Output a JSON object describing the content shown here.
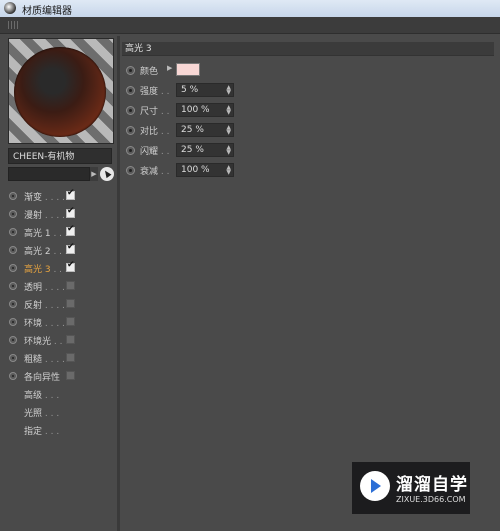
{
  "window": {
    "title": "材质编辑器"
  },
  "material": {
    "name": "CHEEN-有机物"
  },
  "channels": [
    {
      "label": "渐变",
      "dots": " . . . .",
      "checked": true,
      "active": false
    },
    {
      "label": "漫射",
      "dots": " . . . .",
      "checked": true,
      "active": false
    },
    {
      "label": "高光 1",
      "dots": " . . .",
      "checked": true,
      "active": false
    },
    {
      "label": "高光 2",
      "dots": " . . .",
      "checked": true,
      "active": false
    },
    {
      "label": "高光 3",
      "dots": " . . .",
      "checked": true,
      "active": true
    },
    {
      "label": "透明",
      "dots": " . . . .",
      "checked": false,
      "active": false
    },
    {
      "label": "反射",
      "dots": " . . . .",
      "checked": false,
      "active": false
    },
    {
      "label": "环境",
      "dots": " . . . .",
      "checked": false,
      "active": false
    },
    {
      "label": "环境光",
      "dots": " . .",
      "checked": false,
      "active": false
    },
    {
      "label": "粗糙",
      "dots": " . . . .",
      "checked": false,
      "active": false
    },
    {
      "label": "各向异性",
      "dots": "",
      "checked": false,
      "active": false
    }
  ],
  "extra_items": [
    {
      "label": "高级",
      "dots": " . . ."
    },
    {
      "label": "光照",
      "dots": " . . ."
    },
    {
      "label": "指定",
      "dots": " . . ."
    }
  ],
  "section": {
    "title": "高光 3"
  },
  "properties": {
    "color": {
      "label": "颜色",
      "swatch": "#f8d7d5"
    },
    "strength": {
      "label": "强度",
      "dots": " . .",
      "value": "5 %"
    },
    "size": {
      "label": "尺寸",
      "dots": " . .",
      "value": "100 %"
    },
    "contrast": {
      "label": "对比",
      "dots": " . .",
      "value": "25 %"
    },
    "glare": {
      "label": "闪耀",
      "dots": " . .",
      "value": "25 %"
    },
    "falloff": {
      "label": "衰减",
      "dots": " . .",
      "value": "100 %"
    }
  },
  "watermark": {
    "title": "溜溜自学",
    "subtitle": "ZIXUE.3D66.COM"
  }
}
